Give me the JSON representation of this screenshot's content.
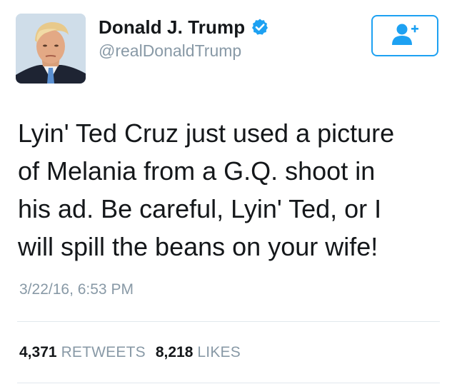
{
  "user": {
    "display_name": "Donald J. Trump",
    "handle": "@realDonaldTrump",
    "verified": true,
    "verified_icon": "verified-badge-icon",
    "avatar_icon": "profile-photo"
  },
  "follow_button": {
    "icon": "add-user-icon"
  },
  "tweet": {
    "lines": [
      "Lyin' Ted Cruz just used a picture",
      "of Melania from a G.Q. shoot in",
      "his ad. Be careful, Lyin' Ted, or I",
      "will spill the beans on your wife!"
    ],
    "timestamp": "3/22/16, 6:53 PM"
  },
  "stats": {
    "retweets_count": "4,371",
    "retweets_label": "RETWEETS",
    "likes_count": "8,218",
    "likes_label": "LIKES"
  },
  "colors": {
    "accent": "#1da1f2",
    "text": "#14171a",
    "muted": "#8899a6",
    "divider": "#e1e8ed"
  }
}
